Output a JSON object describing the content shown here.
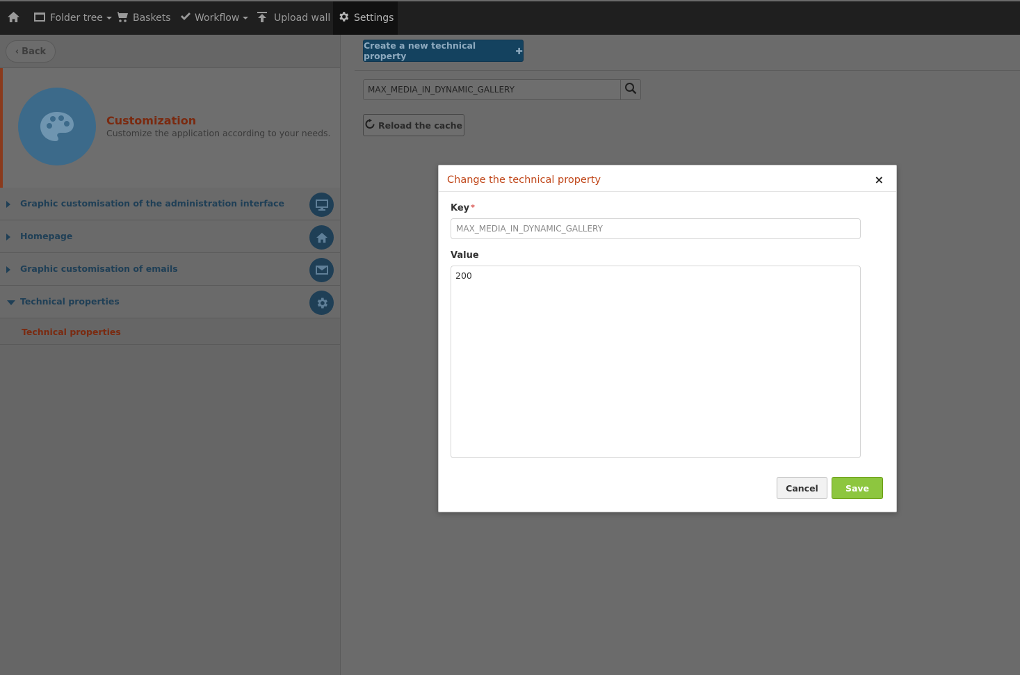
{
  "nav": {
    "home_icon": "home-icon",
    "folder_tree": "Folder tree",
    "baskets": "Baskets",
    "workflow": "Workflow",
    "upload_wall": "Upload wall",
    "settings": "Settings"
  },
  "sidebar": {
    "back_label": "Back",
    "header": {
      "title": "Customization",
      "subtitle": "Customize the application according to your needs."
    },
    "items": [
      {
        "label": "Graphic customisation of the administration interface",
        "icon": "monitor-icon"
      },
      {
        "label": "Homepage",
        "icon": "home-icon"
      },
      {
        "label": "Graphic customisation of emails",
        "icon": "mail-icon"
      },
      {
        "label": "Technical properties",
        "icon": "gear-icon"
      }
    ],
    "subitem": "Technical properties"
  },
  "main": {
    "create_button": "Create a new technical property",
    "search_value": "MAX_MEDIA_IN_DYNAMIC_GALLERY",
    "reload_button": "Reload the cache"
  },
  "modal": {
    "title": "Change the technical property",
    "close": "×",
    "key_label": "Key",
    "required_mark": "*",
    "key_value": "MAX_MEDIA_IN_DYNAMIC_GALLERY",
    "value_label": "Value",
    "value": "200",
    "cancel": "Cancel",
    "save": "Save"
  },
  "colors": {
    "accent_orange": "#c0471a",
    "save_green": "#8dc63f",
    "primary_blue": "#14425f"
  }
}
